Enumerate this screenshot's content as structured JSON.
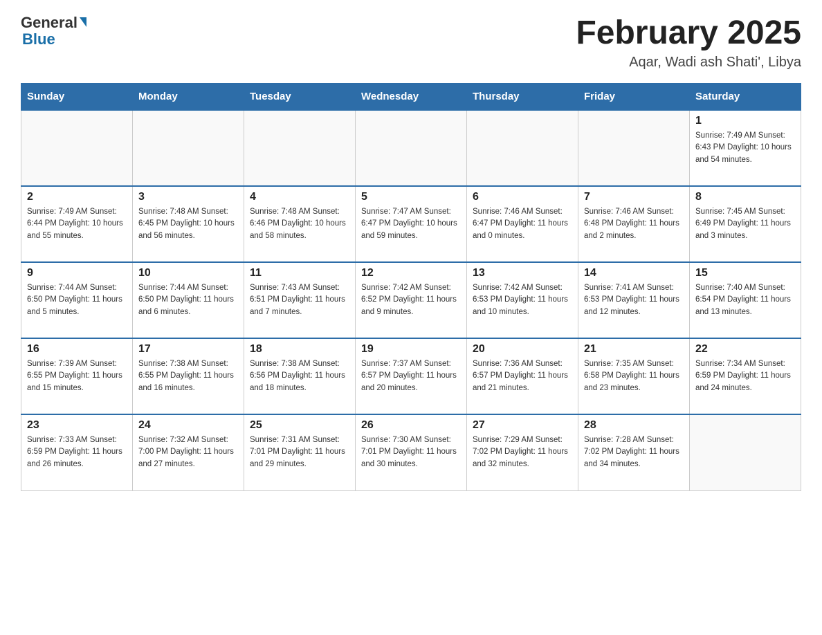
{
  "header": {
    "logo_general": "General",
    "logo_blue": "Blue",
    "title": "February 2025",
    "subtitle": "Aqar, Wadi ash Shati', Libya"
  },
  "days_of_week": [
    "Sunday",
    "Monday",
    "Tuesday",
    "Wednesday",
    "Thursday",
    "Friday",
    "Saturday"
  ],
  "weeks": [
    [
      {
        "day": "",
        "info": ""
      },
      {
        "day": "",
        "info": ""
      },
      {
        "day": "",
        "info": ""
      },
      {
        "day": "",
        "info": ""
      },
      {
        "day": "",
        "info": ""
      },
      {
        "day": "",
        "info": ""
      },
      {
        "day": "1",
        "info": "Sunrise: 7:49 AM\nSunset: 6:43 PM\nDaylight: 10 hours\nand 54 minutes."
      }
    ],
    [
      {
        "day": "2",
        "info": "Sunrise: 7:49 AM\nSunset: 6:44 PM\nDaylight: 10 hours\nand 55 minutes."
      },
      {
        "day": "3",
        "info": "Sunrise: 7:48 AM\nSunset: 6:45 PM\nDaylight: 10 hours\nand 56 minutes."
      },
      {
        "day": "4",
        "info": "Sunrise: 7:48 AM\nSunset: 6:46 PM\nDaylight: 10 hours\nand 58 minutes."
      },
      {
        "day": "5",
        "info": "Sunrise: 7:47 AM\nSunset: 6:47 PM\nDaylight: 10 hours\nand 59 minutes."
      },
      {
        "day": "6",
        "info": "Sunrise: 7:46 AM\nSunset: 6:47 PM\nDaylight: 11 hours\nand 0 minutes."
      },
      {
        "day": "7",
        "info": "Sunrise: 7:46 AM\nSunset: 6:48 PM\nDaylight: 11 hours\nand 2 minutes."
      },
      {
        "day": "8",
        "info": "Sunrise: 7:45 AM\nSunset: 6:49 PM\nDaylight: 11 hours\nand 3 minutes."
      }
    ],
    [
      {
        "day": "9",
        "info": "Sunrise: 7:44 AM\nSunset: 6:50 PM\nDaylight: 11 hours\nand 5 minutes."
      },
      {
        "day": "10",
        "info": "Sunrise: 7:44 AM\nSunset: 6:50 PM\nDaylight: 11 hours\nand 6 minutes."
      },
      {
        "day": "11",
        "info": "Sunrise: 7:43 AM\nSunset: 6:51 PM\nDaylight: 11 hours\nand 7 minutes."
      },
      {
        "day": "12",
        "info": "Sunrise: 7:42 AM\nSunset: 6:52 PM\nDaylight: 11 hours\nand 9 minutes."
      },
      {
        "day": "13",
        "info": "Sunrise: 7:42 AM\nSunset: 6:53 PM\nDaylight: 11 hours\nand 10 minutes."
      },
      {
        "day": "14",
        "info": "Sunrise: 7:41 AM\nSunset: 6:53 PM\nDaylight: 11 hours\nand 12 minutes."
      },
      {
        "day": "15",
        "info": "Sunrise: 7:40 AM\nSunset: 6:54 PM\nDaylight: 11 hours\nand 13 minutes."
      }
    ],
    [
      {
        "day": "16",
        "info": "Sunrise: 7:39 AM\nSunset: 6:55 PM\nDaylight: 11 hours\nand 15 minutes."
      },
      {
        "day": "17",
        "info": "Sunrise: 7:38 AM\nSunset: 6:55 PM\nDaylight: 11 hours\nand 16 minutes."
      },
      {
        "day": "18",
        "info": "Sunrise: 7:38 AM\nSunset: 6:56 PM\nDaylight: 11 hours\nand 18 minutes."
      },
      {
        "day": "19",
        "info": "Sunrise: 7:37 AM\nSunset: 6:57 PM\nDaylight: 11 hours\nand 20 minutes."
      },
      {
        "day": "20",
        "info": "Sunrise: 7:36 AM\nSunset: 6:57 PM\nDaylight: 11 hours\nand 21 minutes."
      },
      {
        "day": "21",
        "info": "Sunrise: 7:35 AM\nSunset: 6:58 PM\nDaylight: 11 hours\nand 23 minutes."
      },
      {
        "day": "22",
        "info": "Sunrise: 7:34 AM\nSunset: 6:59 PM\nDaylight: 11 hours\nand 24 minutes."
      }
    ],
    [
      {
        "day": "23",
        "info": "Sunrise: 7:33 AM\nSunset: 6:59 PM\nDaylight: 11 hours\nand 26 minutes."
      },
      {
        "day": "24",
        "info": "Sunrise: 7:32 AM\nSunset: 7:00 PM\nDaylight: 11 hours\nand 27 minutes."
      },
      {
        "day": "25",
        "info": "Sunrise: 7:31 AM\nSunset: 7:01 PM\nDaylight: 11 hours\nand 29 minutes."
      },
      {
        "day": "26",
        "info": "Sunrise: 7:30 AM\nSunset: 7:01 PM\nDaylight: 11 hours\nand 30 minutes."
      },
      {
        "day": "27",
        "info": "Sunrise: 7:29 AM\nSunset: 7:02 PM\nDaylight: 11 hours\nand 32 minutes."
      },
      {
        "day": "28",
        "info": "Sunrise: 7:28 AM\nSunset: 7:02 PM\nDaylight: 11 hours\nand 34 minutes."
      },
      {
        "day": "",
        "info": ""
      }
    ]
  ]
}
